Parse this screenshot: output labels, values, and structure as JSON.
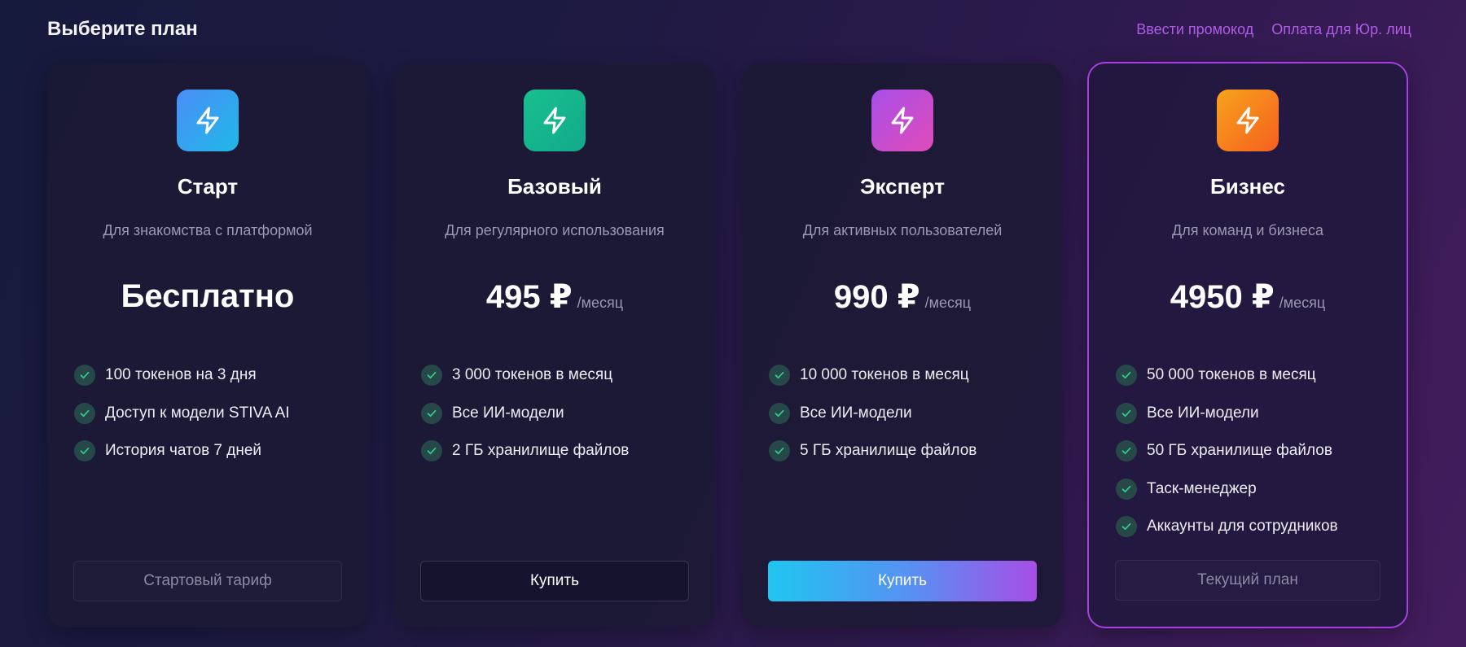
{
  "header": {
    "title": "Выберите план",
    "links": [
      "Ввести промокод",
      "Оплата для Юр. лиц"
    ]
  },
  "plans": [
    {
      "name": "Старт",
      "description": "Для знакомства с платформой",
      "price": "Бесплатно",
      "period": "",
      "features": [
        "100 токенов на 3 дня",
        "Доступ к модели STIVA AI",
        "История чатов 7 дней"
      ],
      "button": "Стартовый тариф",
      "icon_colors": [
        "#4b8df8",
        "#1fb9e6"
      ]
    },
    {
      "name": "Базовый",
      "description": "Для регулярного использования",
      "price": "495 ₽",
      "period": "/месяц",
      "features": [
        "3 000 токенов в месяц",
        "Все ИИ-модели",
        "2 ГБ хранилище файлов"
      ],
      "button": "Купить",
      "icon_colors": [
        "#18c08e",
        "#12a98c"
      ]
    },
    {
      "name": "Эксперт",
      "description": "Для активных пользователей",
      "price": "990 ₽",
      "period": "/месяц",
      "features": [
        "10 000 токенов в месяц",
        "Все ИИ-модели",
        "5 ГБ хранилище файлов"
      ],
      "button": "Купить",
      "icon_colors": [
        "#a84ee8",
        "#e04cb8"
      ]
    },
    {
      "name": "Бизнес",
      "description": "Для команд и бизнеса",
      "price": "4950 ₽",
      "period": "/месяц",
      "features": [
        "50 000 токенов в месяц",
        "Все ИИ-модели",
        "50 ГБ хранилище файлов",
        "Таск-менеджер",
        "Аккаунты для сотрудников"
      ],
      "button": "Текущий план",
      "icon_colors": [
        "#f7a21c",
        "#f5601e"
      ]
    }
  ],
  "colors": {
    "accent_link": "#b05ce6",
    "current_plan_border": "#a53fe0",
    "check_green": "#2fc98e"
  },
  "icons": {
    "plan_icon": "lightning-bolt-icon",
    "feature_icon": "check-icon"
  }
}
